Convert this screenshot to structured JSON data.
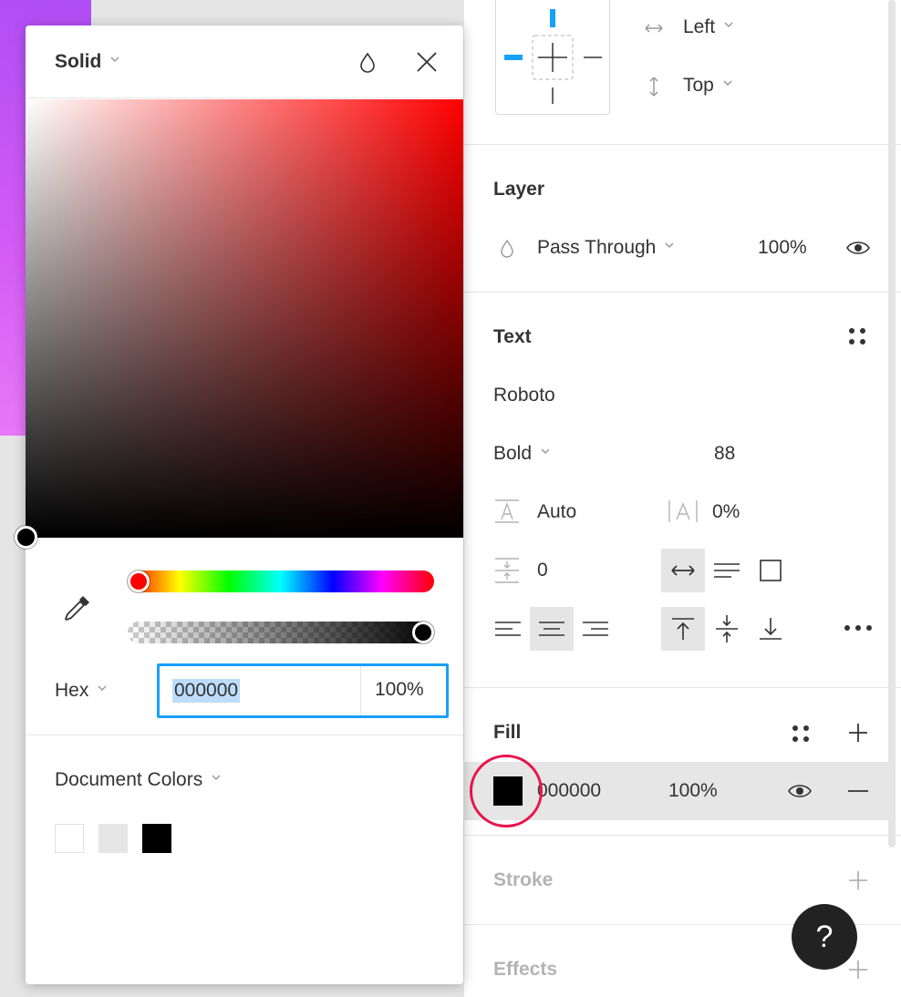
{
  "constraints": {
    "horizontal": "Left",
    "vertical": "Top"
  },
  "layer": {
    "title": "Layer",
    "blend_mode": "Pass Through",
    "opacity": "100%"
  },
  "text": {
    "title": "Text",
    "font_family": "Roboto",
    "font_weight": "Bold",
    "font_size": "88",
    "line_height": "Auto",
    "letter_spacing": "0%",
    "paragraph_spacing": "0"
  },
  "fill": {
    "title": "Fill",
    "hex": "000000",
    "opacity": "100%",
    "swatch_color": "#000000"
  },
  "stroke": {
    "title": "Stroke"
  },
  "effects": {
    "title": "Effects"
  },
  "help": {
    "label": "?"
  },
  "picker": {
    "mode": "Solid",
    "color_model": "Hex",
    "hex_value": "000000",
    "alpha_value": "100%",
    "document_colors_label": "Document Colors",
    "document_colors": [
      "#ffffff",
      "#e6e6e6",
      "#000000"
    ],
    "hue_color": "#ff0000"
  },
  "colors": {
    "accent": "#18a0fb",
    "highlight": "#e8154b"
  }
}
